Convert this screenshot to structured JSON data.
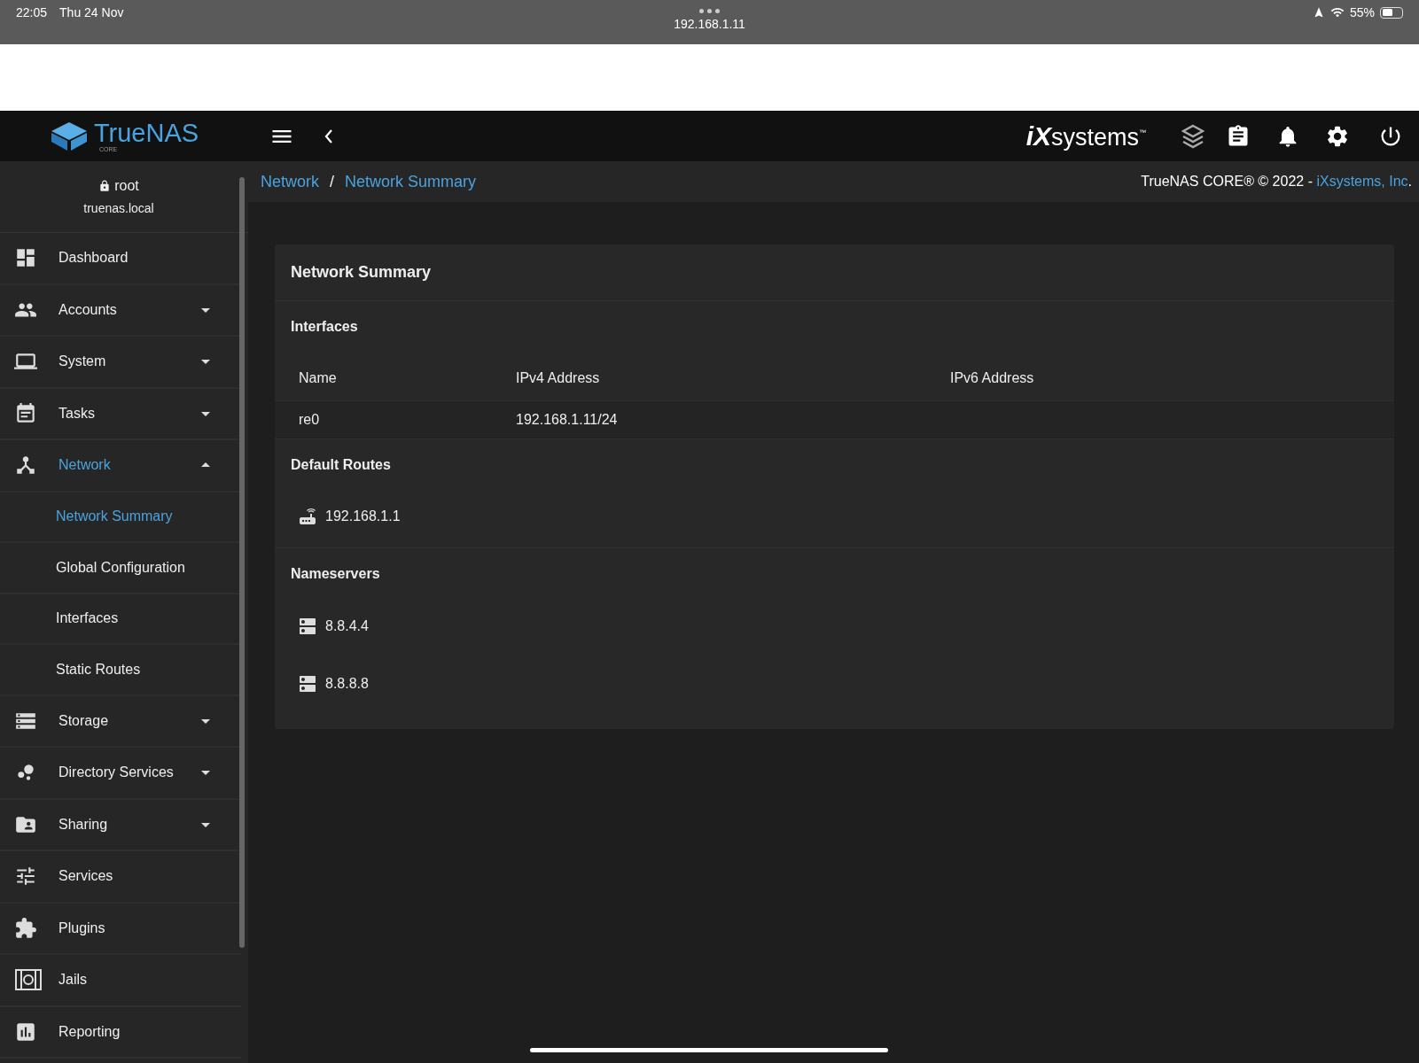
{
  "status_bar": {
    "time": "22:05",
    "date": "Thu 24 Nov",
    "url": "192.168.1.11",
    "battery": "55%"
  },
  "topbar": {
    "logo": "TrueNAS",
    "logo_sub": "CORE",
    "brand_ix": "iX",
    "brand_rest": "systems",
    "brand_tm": "™"
  },
  "user": {
    "name": "root",
    "host": "truenas.local"
  },
  "sidebar": {
    "items": [
      {
        "label": "Dashboard",
        "selected": false
      },
      {
        "label": "Accounts",
        "selected": false,
        "expanded": false
      },
      {
        "label": "System",
        "selected": false,
        "expanded": false
      },
      {
        "label": "Tasks",
        "selected": false,
        "expanded": false
      },
      {
        "label": "Network",
        "selected": true,
        "expanded": true,
        "children": [
          {
            "label": "Network Summary",
            "selected": true
          },
          {
            "label": "Global Configuration",
            "selected": false
          },
          {
            "label": "Interfaces",
            "selected": false
          },
          {
            "label": "Static Routes",
            "selected": false
          }
        ]
      },
      {
        "label": "Storage",
        "selected": false,
        "expanded": false
      },
      {
        "label": "Directory Services",
        "selected": false,
        "expanded": false
      },
      {
        "label": "Sharing",
        "selected": false,
        "expanded": false
      },
      {
        "label": "Services",
        "selected": false
      },
      {
        "label": "Plugins",
        "selected": false
      },
      {
        "label": "Jails",
        "selected": false
      },
      {
        "label": "Reporting",
        "selected": false
      }
    ]
  },
  "breadcrumb": [
    "Network",
    "Network Summary"
  ],
  "breadcrumb_separator": "/",
  "copyright": {
    "text": "TrueNAS CORE® © 2022 - ",
    "link": "iXsystems, Inc",
    "end": "."
  },
  "card": {
    "title": "Network Summary",
    "interfaces": {
      "title": "Interfaces",
      "columns": [
        "Name",
        "IPv4 Address",
        "IPv6 Address"
      ],
      "rows": [
        [
          "re0",
          "192.168.1.11/24",
          ""
        ]
      ]
    },
    "routes": {
      "title": "Default Routes",
      "items": [
        "192.168.1.1"
      ]
    },
    "nameservers": {
      "title": "Nameservers",
      "items": [
        "8.8.4.4",
        "8.8.8.8"
      ]
    }
  }
}
